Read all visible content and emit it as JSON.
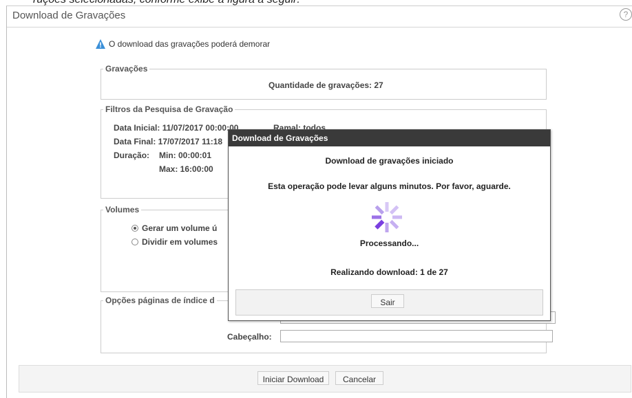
{
  "caption": "ruções selecionadas, conforme exibe a figura a seguir:",
  "window": {
    "title": "Download de Gravações",
    "help": "?"
  },
  "warning": "O download das gravações poderá demorar",
  "gravacoes": {
    "legend": "Gravações",
    "count_label": "Quantidade de gravações: 27"
  },
  "filtros": {
    "legend": "Filtros da Pesquisa de Gravação",
    "data_inicial": "Data Inicial: 11/07/2017 00:00:00",
    "data_final": "Data Final: 17/07/2017 11:18",
    "duracao_label": "Duração:",
    "min": "Min: 00:00:01",
    "max": "Max: 16:00:00",
    "ramal": "Ramal: todos"
  },
  "volumes": {
    "legend": "Volumes",
    "options": [
      "Gerar um volume ú",
      "Dividir em volumes"
    ],
    "selected": 0
  },
  "opcoes": {
    "legend": "Opções páginas de índice d",
    "cabecalho_label": "Cabeçalho:"
  },
  "footer": {
    "start_label": "Iniciar Download",
    "cancel_label": "Cancelar"
  },
  "dialog": {
    "title": "Download de Gravações",
    "heading": "Download de gravações iniciado",
    "message": "Esta operação pode levar alguns minutos. Por favor, aguarde.",
    "status": "Processando...",
    "progress": "Realizando download: 1 de 27",
    "exit_label": "Sair"
  },
  "colors": {
    "dialog_title_bg": "#3a3a3a",
    "spinner": "#7a3fe0",
    "warning_icon": "#3a8fd8"
  }
}
